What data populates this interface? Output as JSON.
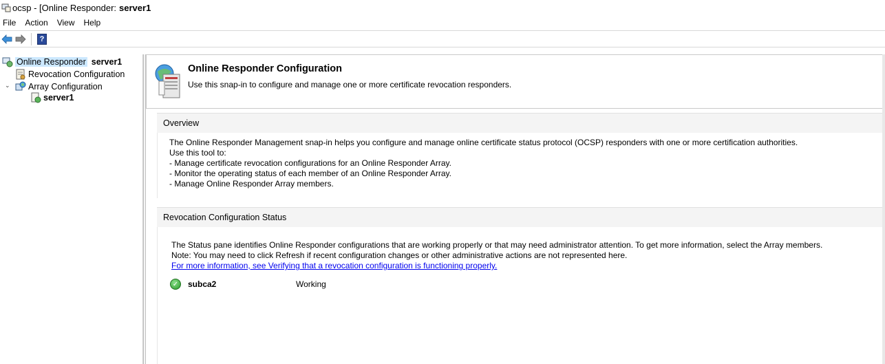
{
  "window": {
    "title_prefix": "ocsp - [Online Responder:",
    "title_server": "server1"
  },
  "menu": [
    "File",
    "Action",
    "View",
    "Help"
  ],
  "toolbar": {
    "back_icon": "back-arrow-icon",
    "forward_icon": "forward-arrow-icon",
    "help_label": "?"
  },
  "tree": {
    "root": {
      "label": "Online Responder",
      "server": "server1"
    },
    "revocation": {
      "label": "Revocation Configuration"
    },
    "array": {
      "label": "Array Configuration",
      "expander": "⌄"
    },
    "member": {
      "label": "server1"
    }
  },
  "header": {
    "title": "Online Responder Configuration",
    "subtitle": "Use this snap-in to configure and manage one or more certificate revocation responders."
  },
  "overview": {
    "heading": "Overview",
    "lines": [
      "The Online Responder Management snap-in helps you configure and manage online certificate status protocol (OCSP) responders with one or more certification authorities.",
      "Use this tool to:",
      "-  Manage certificate revocation configurations for an Online Responder Array.",
      "-  Monitor the operating status of each member of an Online Responder Array.",
      "-  Manage Online Responder Array members."
    ]
  },
  "revocation_status": {
    "heading": "Revocation Configuration Status",
    "line1": "The Status pane identifies Online Responder configurations that are working properly or that may need administrator attention. To get more information, select the Array members.",
    "line2": "Note: You may need to click Refresh if recent configuration changes or other administrative actions are not represented here.",
    "link": "For more information, see Verifying that a revocation configuration is functioning properly.",
    "items": [
      {
        "name": "subca2",
        "status": "Working",
        "icon": "check-ok-icon"
      }
    ]
  },
  "colors": {
    "selection": "#cce8ff",
    "link": "#0000ee",
    "ok_green": "#2a9a2a"
  }
}
